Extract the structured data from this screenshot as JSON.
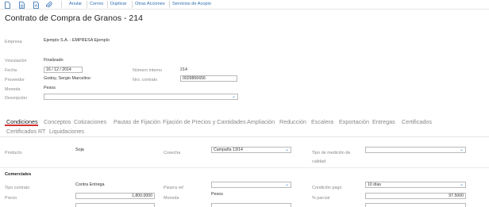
{
  "toolbar": {
    "icons": [
      "document-icon",
      "document-lines-icon",
      "pdf-icon",
      "attachment-icon"
    ],
    "actions": [
      "Anular",
      "Correo",
      "Duplicar",
      "Otras Acciones",
      "Servicios de Acopio"
    ]
  },
  "title": "Contrato de Compra de Granos - 214",
  "empresa": {
    "label": "Empresa",
    "value": "Ejemplo S.A. - EMPRESA Ejemplo"
  },
  "vinculacion": {
    "label": "Vinculación",
    "value": "Finalizado"
  },
  "fecha": {
    "label": "Fecha",
    "day": "16",
    "month": "12",
    "year": "2014",
    "sep": "/"
  },
  "numero_interno": {
    "label": "Número interno",
    "value": "214"
  },
  "proveedor": {
    "label": "Proveedor",
    "value": "Godoy, Sergio Marcelino"
  },
  "nro_contrato": {
    "label": "Nro. contrato",
    "value": "0029856656"
  },
  "moneda_header": {
    "label": "Moneda",
    "value": "Pesos"
  },
  "descripcion": {
    "label": "Descripción",
    "value": ""
  },
  "tabs": {
    "row1": [
      "Condiciones",
      "Conceptos",
      "Cotizaciones",
      "Pautas de Fijación",
      "Fijación de Precios y Cantidades",
      "Ampliación",
      "Reducción",
      "Escalera",
      "Exportación",
      "Entregas",
      "Certificados"
    ],
    "row2": [
      "Certificados RT",
      "Liquidaciones"
    ]
  },
  "condiciones": {
    "producto": {
      "label": "Producto",
      "value": "Soja"
    },
    "cosecha": {
      "label": "Cosecha",
      "value": "Campaña 13/14"
    },
    "tipo_medicion": {
      "label1": "Tipo de medición de",
      "label2": "calidad",
      "value": ""
    }
  },
  "comerciales": {
    "section_title": "Comerciales",
    "tipo_contrato": {
      "label": "Tipo contrato",
      "value": "Contra Entrega"
    },
    "pizarra_ref": {
      "label": "Pizarra ref",
      "value": ""
    },
    "condicion_pago": {
      "label": "Condición pago",
      "value": "10 días"
    },
    "precio": {
      "label": "Precio",
      "value": "1,800.0000"
    },
    "moneda": {
      "label": "Moneda",
      "value": "Pesos"
    },
    "pct_parcial": {
      "label": "% parcial",
      "value": "97.5000"
    }
  },
  "colors": {
    "link": "#2b6cb0",
    "active_tab_underline": "#d32f2f",
    "chevron": "#3b7bd5"
  }
}
